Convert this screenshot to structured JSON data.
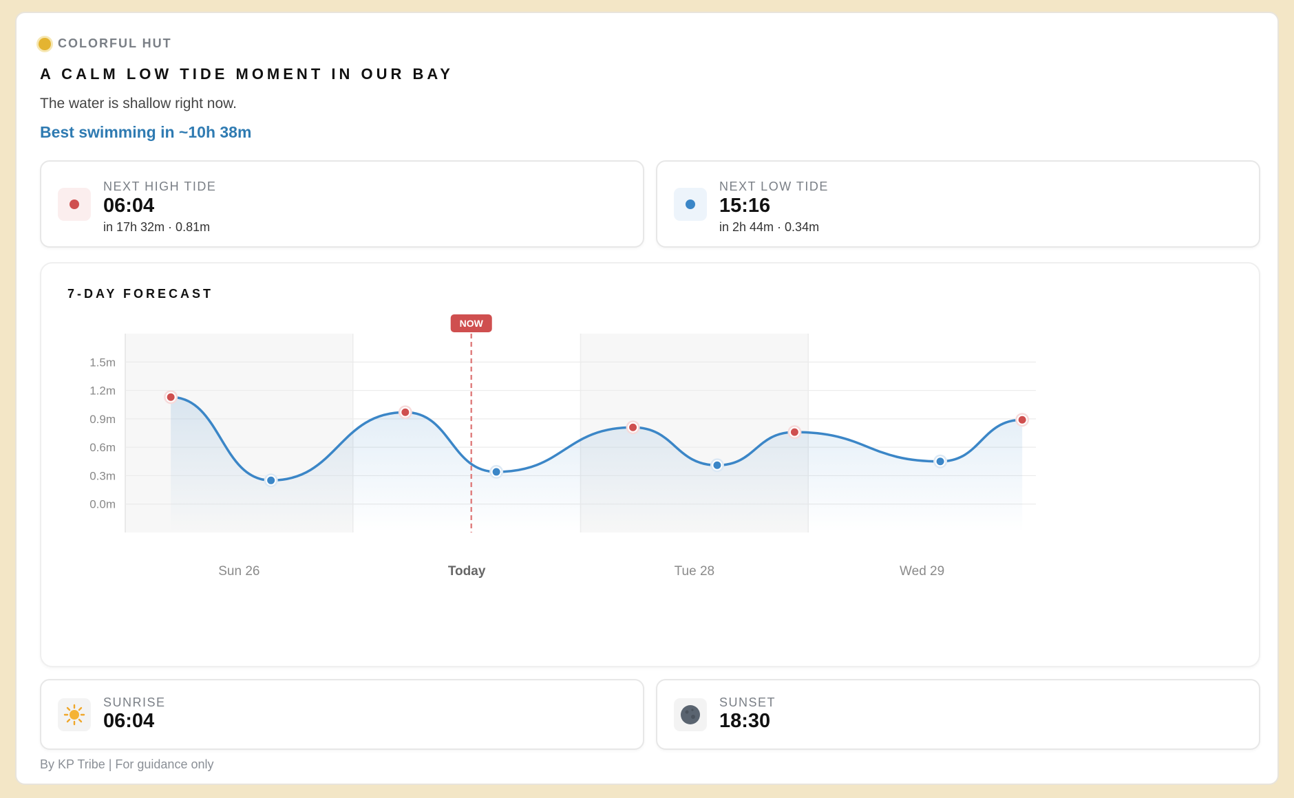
{
  "brand": {
    "name": "COLORFUL HUT",
    "dot_color": "#e4b431"
  },
  "headline": "A CALM LOW TIDE MOMENT IN OUR BAY",
  "subtext": "The water is shallow right now.",
  "swim_hint": "Best swimming in ~10h 38m",
  "next_high": {
    "label": "NEXT HIGH TIDE",
    "time": "06:04",
    "detail": "in 17h 32m · 0.81m",
    "color": "#cf4f4f"
  },
  "next_low": {
    "label": "NEXT LOW TIDE",
    "time": "15:16",
    "detail": "in 2h 44m · 0.34m",
    "color": "#3b86c7"
  },
  "forecast": {
    "title": "7-DAY FORECAST",
    "now_label": "NOW"
  },
  "chart_data": {
    "type": "line",
    "title": "7-DAY FORECAST",
    "xlabel": "",
    "ylabel": "",
    "y_ticks": [
      "1.5m",
      "1.2m",
      "0.9m",
      "0.6m",
      "0.3m",
      "0.0m"
    ],
    "ylim": [
      -0.3,
      1.8
    ],
    "categories": [
      "Sun 26",
      "Today",
      "Tue 28",
      "Wed 29"
    ],
    "highlight_category": "Today",
    "now_day": 1.52,
    "series": [
      {
        "x": [
          0.2,
          0.64,
          1.23,
          1.63,
          2.23,
          2.6,
          2.94,
          3.58,
          3.94
        ],
        "y": [
          1.13,
          0.25,
          0.97,
          0.34,
          0.81,
          0.41,
          0.76,
          0.45,
          0.89
        ],
        "kind": [
          "high",
          "low",
          "high",
          "low",
          "high",
          "low",
          "high",
          "low",
          "high"
        ]
      }
    ],
    "colors": {
      "line": "#3b86c7",
      "high": "#cf4f4f",
      "low": "#3b86c7",
      "now": "#e08080"
    },
    "grid": true,
    "legend": "none"
  },
  "sunrise": {
    "label": "SUNRISE",
    "time": "06:04"
  },
  "sunset": {
    "label": "SUNSET",
    "time": "18:30"
  },
  "footer": "By KP Tribe | For guidance only"
}
